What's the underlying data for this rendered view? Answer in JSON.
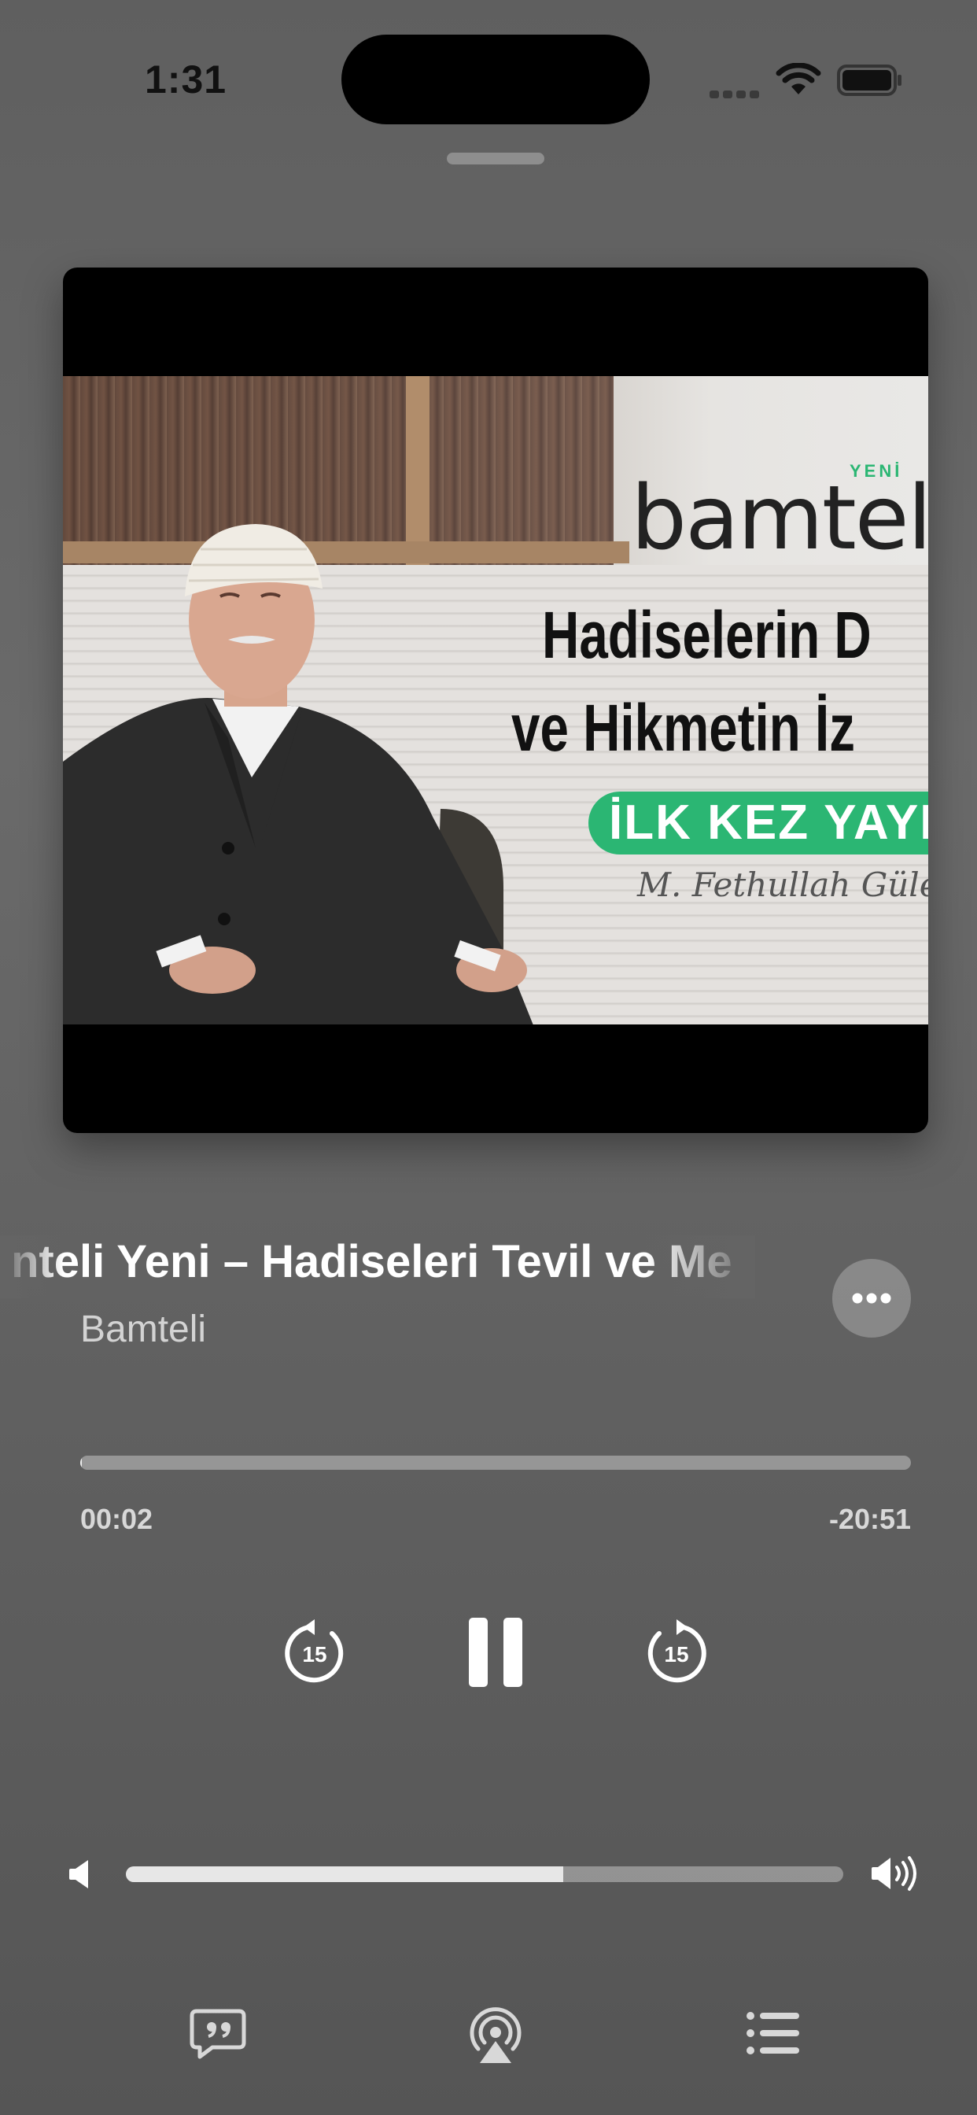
{
  "status": {
    "time": "1:31"
  },
  "artwork": {
    "brand_small": "YENİ",
    "brand": "bamteli",
    "headline_line1": "Hadiselerin D",
    "headline_line2": "ve Hikmetin İz",
    "banner": "İLK KEZ YAYIND",
    "signature": "M. Fethullah Gülen"
  },
  "track": {
    "title": "nteli Yeni – Hadiseleri Tevil ve Me",
    "artist": "Bamteli"
  },
  "playback": {
    "elapsed": "00:02",
    "remaining": "-20:51",
    "progress": 0.002,
    "skip_seconds": "15"
  },
  "volume": {
    "level": 0.61
  },
  "icons": {
    "more": "ellipsis-icon",
    "rewind": "gobackward-15-icon",
    "pause": "pause-icon",
    "forward": "goforward-15-icon",
    "volume_low": "speaker-low-icon",
    "volume_high": "speaker-high-icon",
    "lyrics": "quote-bubble-icon",
    "airplay": "airplay-audio-icon",
    "queue": "list-bullet-icon"
  },
  "colors": {
    "accent_green": "#2bb673",
    "background": "#646464"
  }
}
